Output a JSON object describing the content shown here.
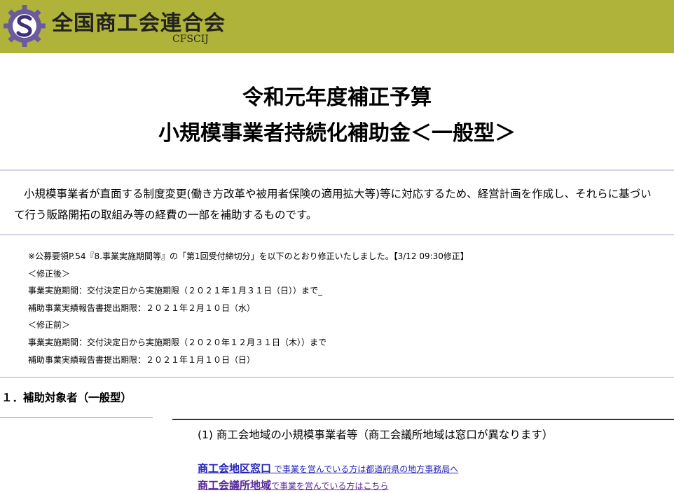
{
  "header": {
    "org_name": "全国商工会連合会",
    "org_abbr": "CFSCIJ",
    "bg_color": "#b0b339"
  },
  "title": {
    "line1": "令和元年度補正予算",
    "line2": "小規模事業者持続化補助金＜一般型＞"
  },
  "intro": {
    "text": "小規模事業者が直面する制度変更(働き方改革や被用者保険の適用拡大等)等に対応するため、経営計画を作成し、それらに基づいて行う販路開拓の取組み等の経費の一部を補助するものです。"
  },
  "notice": {
    "lines": [
      "※公募要領P.54『8.事業実施期間等』の「第1回受付締切分」を以下のとおり修正いたしました。【3/12 09:30修正】",
      "＜修正後＞",
      "事業実施期間：交付決定日から実施期限（２０２１年１月３１日（日））まで_",
      "補助事業実績報告書提出期限：２０２１年２月１０日（水）",
      "＜修正前＞",
      "事業実施期間：交付決定日から実施期限（２０２０年１２月３１日（木））まで",
      "補助事業実績報告書提出期限：２０２１年１月１０日（日）"
    ]
  },
  "section1": {
    "title": "１．補助対象者（一般型）",
    "sub_heading": "(1) 商工会地域の小規模事業者等（商工会議所地域は窓口が異なります）",
    "links": [
      {
        "main": "商工会地区窓口",
        "sub": " で事業を営んでいる方は都道府県の地方事務局へ"
      },
      {
        "main": "商工会議所地域",
        "sub": "で事業を営んでいる方はこちら"
      }
    ]
  }
}
